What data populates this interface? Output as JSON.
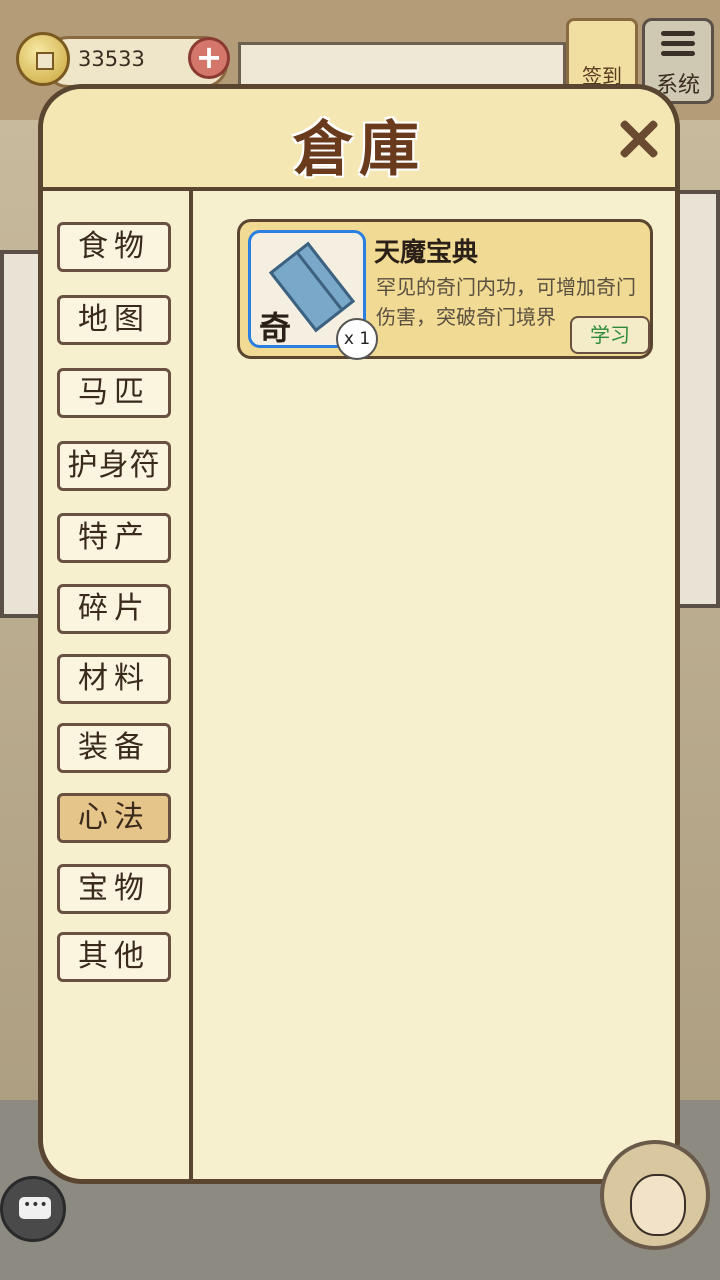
{
  "hud": {
    "coins": "33533",
    "signin_label": "签到",
    "system_label": "系统"
  },
  "warehouse": {
    "title": "倉庫",
    "categories": [
      {
        "label": "食物"
      },
      {
        "label": "地图"
      },
      {
        "label": "马匹"
      },
      {
        "label": "护身符"
      },
      {
        "label": "特产"
      },
      {
        "label": "碎片"
      },
      {
        "label": "材料"
      },
      {
        "label": "装备"
      },
      {
        "label": "心法",
        "selected": true
      },
      {
        "label": "宝物"
      },
      {
        "label": "其他"
      }
    ],
    "items": [
      {
        "type_mark": "奇",
        "name": "天魔宝典",
        "description": "罕见的奇门内功，可增加奇门伤害，突破奇门境界",
        "quantity": "x 1",
        "action_label": "学习",
        "icon": "book-icon"
      }
    ]
  },
  "icons": {
    "coin": "coin-icon",
    "add": "plus-icon",
    "close": "close-icon",
    "chat": "chat-icon",
    "system": "menu-icon"
  },
  "colors": {
    "panel_bg": "#f7f0cf",
    "panel_border": "#5a4530",
    "selected_tab": "#e6c58b",
    "learn_text": "#2e8a3a"
  }
}
